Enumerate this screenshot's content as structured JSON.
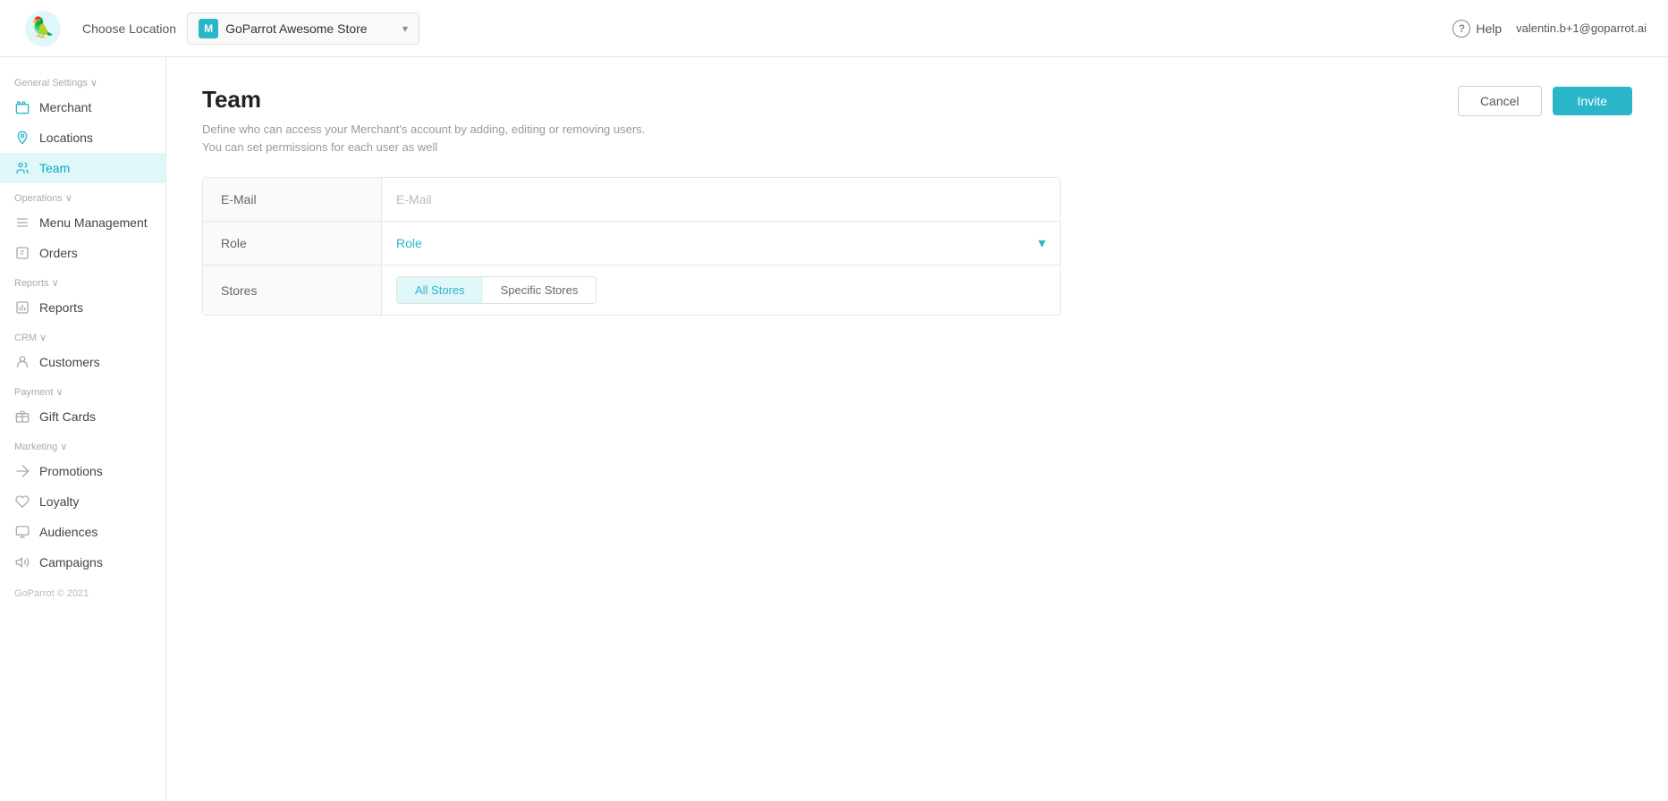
{
  "header": {
    "choose_location_label": "Choose Location",
    "location_badge": "M",
    "location_name": "GoParrot Awesome Store",
    "help_label": "Help",
    "user_email": "valentin.b+1@goparrot.ai"
  },
  "sidebar": {
    "general_settings_label": "General Settings ∨",
    "items_general": [
      {
        "id": "merchant",
        "label": "Merchant",
        "icon": "store"
      },
      {
        "id": "locations",
        "label": "Locations",
        "icon": "location"
      },
      {
        "id": "team",
        "label": "Team",
        "icon": "team",
        "active": true
      }
    ],
    "operations_label": "Operations ∨",
    "items_operations": [
      {
        "id": "menu-management",
        "label": "Menu Management",
        "icon": "menu"
      },
      {
        "id": "orders",
        "label": "Orders",
        "icon": "orders"
      }
    ],
    "reports_label": "Reports ∨",
    "items_reports": [
      {
        "id": "reports",
        "label": "Reports",
        "icon": "reports"
      }
    ],
    "crm_label": "CRM ∨",
    "items_crm": [
      {
        "id": "customers",
        "label": "Customers",
        "icon": "customers"
      }
    ],
    "payment_label": "Payment ∨",
    "items_payment": [
      {
        "id": "gift-cards",
        "label": "Gift Cards",
        "icon": "gift"
      }
    ],
    "marketing_label": "Marketing ∨",
    "items_marketing": [
      {
        "id": "promotions",
        "label": "Promotions",
        "icon": "promotions"
      },
      {
        "id": "loyalty",
        "label": "Loyalty",
        "icon": "loyalty"
      },
      {
        "id": "audiences",
        "label": "Audiences",
        "icon": "audiences"
      },
      {
        "id": "campaigns",
        "label": "Campaigns",
        "icon": "campaigns"
      }
    ],
    "footer_label": "GoParrot © 2021"
  },
  "page": {
    "title": "Team",
    "description": "Define who can access your Merchant's account by adding, editing or removing users. You can set permissions for each user as well",
    "cancel_label": "Cancel",
    "invite_label": "Invite"
  },
  "form": {
    "email_label": "E-Mail",
    "email_placeholder": "E-Mail",
    "role_label": "Role",
    "role_placeholder": "Role",
    "stores_label": "Stores",
    "all_stores_label": "All Stores",
    "specific_stores_label": "Specific Stores"
  }
}
